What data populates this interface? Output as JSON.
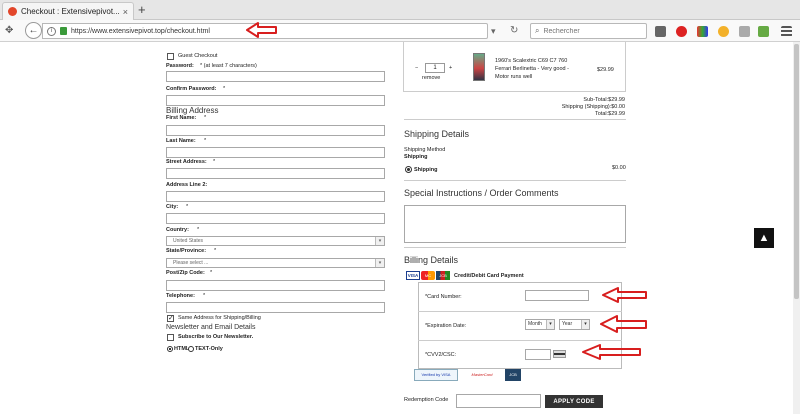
{
  "browser": {
    "tab_title": "Checkout : Extensivepivot...",
    "tab_close": "×",
    "new_tab": "+",
    "url": "https://www.extensivepivot.top/checkout.html",
    "info": "i",
    "search_placeholder": "Rechercher",
    "nav_move": "✥",
    "back": "←",
    "url_tools": "▾",
    "reload": "↻",
    "search_mag": "⌕"
  },
  "account": {
    "guest_checkout": "Guest Checkout",
    "password_label": "Password:",
    "password_hint": "* (at least 7 characters)",
    "confirm_label": "Confirm Password:",
    "confirm_req": "*"
  },
  "billing_address": {
    "title": "Billing Address",
    "fields": [
      {
        "label": "First Name:",
        "req": "*"
      },
      {
        "label": "Last Name:",
        "req": "*"
      },
      {
        "label": "Street Address:",
        "req": "*"
      },
      {
        "label": "Address Line 2:",
        "req": ""
      },
      {
        "label": "City:",
        "req": "*"
      },
      {
        "label": "Country:",
        "req": "*"
      }
    ],
    "country_value": "United States",
    "state_label": "State/Province:",
    "state_req": "*",
    "state_value": "Please select ...",
    "zip_label": "Post/Zip Code:",
    "zip_req": "*",
    "phone_label": "Telephone:",
    "phone_req": "*",
    "same_address": "Same Address for Shipping/Billing",
    "select_arrow": "▾"
  },
  "newsletter": {
    "title": "Newsletter and Email Details",
    "subscribe": "Subscribe to Our Newsletter.",
    "html": "HTML",
    "text": "TEXT-Only"
  },
  "cart": {
    "qty_minus": "−",
    "qty_plus": "+",
    "qty": "1",
    "remove": "remove",
    "item_line1": "1960's Scalextric C69 C7 760",
    "item_line2": "Ferrari Berlinetta - Very good -",
    "item_line3": "Motor runs well",
    "item_price": "$29.99",
    "subtotal": "Sub-Total:$29.99",
    "shipping": "Shipping (Shipping):$0.00",
    "total": "Total:$29.99"
  },
  "shipping": {
    "title": "Shipping Details",
    "method_label": "Shipping Method",
    "method_sub": "Shipping",
    "option": "Shipping",
    "price": "$0.00"
  },
  "comments": {
    "title": "Special Instructions / Order Comments"
  },
  "billing_details": {
    "title": "Billing Details",
    "payment_label": "Credit/Debit Card Payment",
    "card_number_label": "*Card Number:",
    "expiry_label": "*Expiration Date:",
    "month_value": "Month",
    "year_value": "Year",
    "cvv_label": "*CVV2/CSC:",
    "redemption_label": "Redemption Code",
    "apply_label": "APPLY CODE"
  },
  "page": {
    "to_top": "▲"
  },
  "logos": {
    "visa": "VISA",
    "mastercard": "MC",
    "jcb": "JCB",
    "verified": "Verified by VISA",
    "securecode": "MasterCard SecureCode",
    "jcb_secure": "JCB"
  }
}
